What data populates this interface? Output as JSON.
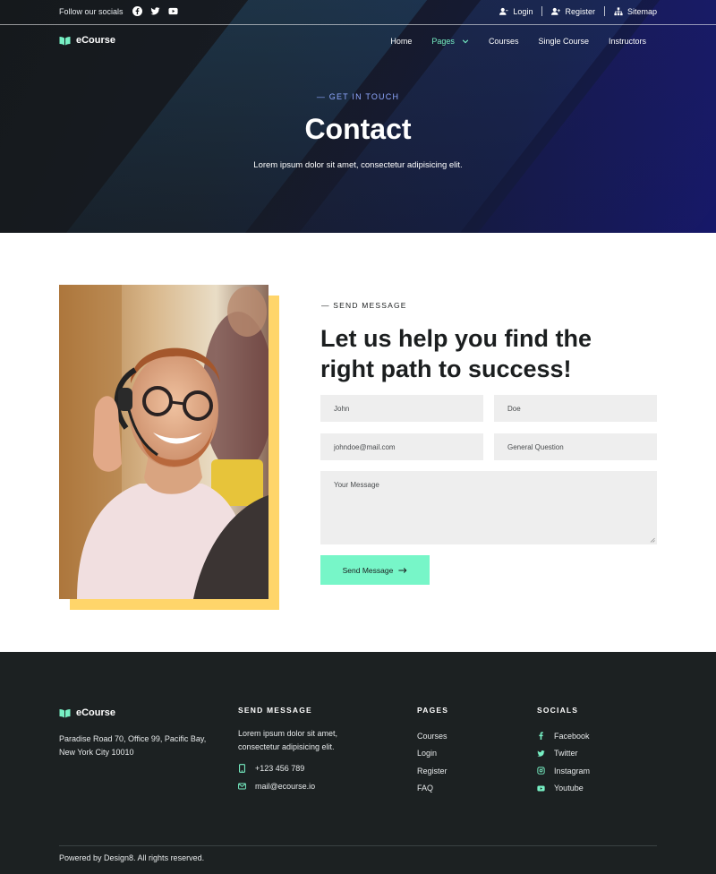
{
  "topbar": {
    "follow_text": "Follow our socials",
    "social_icons": [
      "facebook-icon",
      "twitter-icon",
      "youtube-icon"
    ],
    "login": "Login",
    "register": "Register",
    "sitemap": "Sitemap"
  },
  "nav": {
    "brand": "eCourse",
    "items": [
      {
        "label": "Home",
        "active": false
      },
      {
        "label": "Pages",
        "active": true,
        "has_dropdown": true
      },
      {
        "label": "Courses",
        "active": false
      },
      {
        "label": "Single Course",
        "active": false
      },
      {
        "label": "Instructors",
        "active": false
      }
    ]
  },
  "hero": {
    "eyebrow": "— GET IN TOUCH",
    "title": "Contact",
    "subtitle": "Lorem ipsum dolor sit amet, consectetur adipisicing elit."
  },
  "contact": {
    "eyebrow": "— SEND MESSAGE",
    "title": "Let us help you find the right path to success!",
    "form": {
      "first_name": "John",
      "last_name": "Doe",
      "email": "johndoe@mail.com",
      "subject": "General Question",
      "message_placeholder": "Your Message",
      "submit_label": "Send Message"
    }
  },
  "footer": {
    "brand": "eCourse",
    "address": "Paradise Road 70, Office 99, Pacific Bay,  New York City 10010",
    "send": {
      "heading": "SEND MESSAGE",
      "text": "Lorem ipsum dolor sit amet, consectetur adipisicing elit.",
      "phone": "+123 456 789",
      "email": "mail@ecourse.io"
    },
    "pages": {
      "heading": "PAGES",
      "items": [
        "Courses",
        "Login",
        "Register",
        "FAQ"
      ]
    },
    "socials": {
      "heading": "SOCIALS",
      "items": [
        "Facebook",
        "Twitter",
        "Instagram",
        "Youtube"
      ]
    },
    "copyright": "Powered by Design8. All rights reserved."
  },
  "colors": {
    "accent": "#77f6c8",
    "photo_frame": "#ffd56a",
    "footer_bg": "#1c2122",
    "eyebrow_blue": "#8fa8ff"
  }
}
